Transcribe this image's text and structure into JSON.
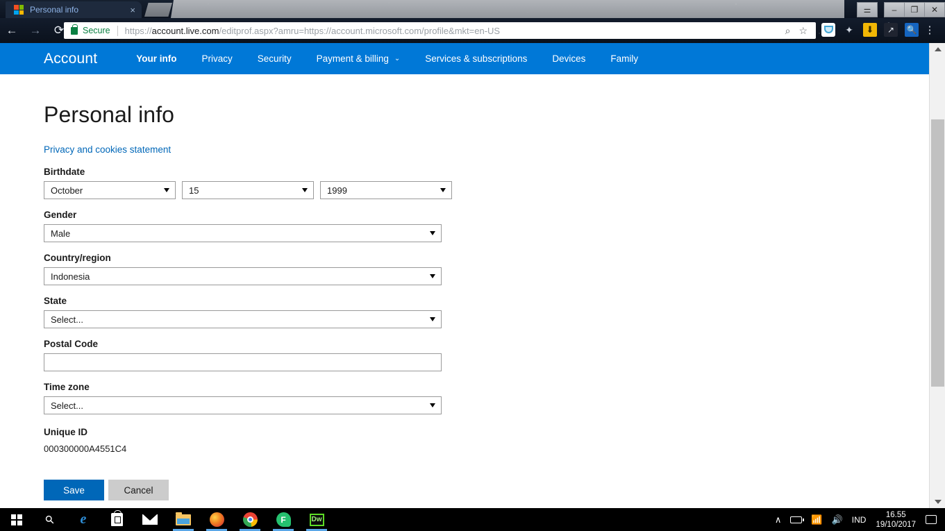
{
  "browser": {
    "tab": {
      "title": "Personal info",
      "favicon": "microsoft-logo-icon",
      "close": "×"
    },
    "nav": {
      "back": "←",
      "forward": "→",
      "reload": "⟳"
    },
    "omnibox": {
      "secure_label": "Secure",
      "url_prefix": "https://",
      "url_domain": "account.live.com",
      "url_path": "/editprof.aspx?amru=https://account.microsoft.com/profile&mkt=en-US",
      "zoom_icon": "⌕",
      "bookmark_icon": "☆"
    },
    "extensions": [
      "pocket-icon",
      "star-icon",
      "download-icon",
      "screenshot-icon",
      "magnifier-icon"
    ],
    "menu_icon": "⋮",
    "window_controls": {
      "profile": "⚌",
      "minimize": "–",
      "restore": "❐",
      "close": "✕"
    }
  },
  "site_nav": {
    "brand": "Account",
    "items": [
      {
        "label": "Your info",
        "active": true,
        "chevron": ""
      },
      {
        "label": "Privacy",
        "active": false,
        "chevron": ""
      },
      {
        "label": "Security",
        "active": false,
        "chevron": ""
      },
      {
        "label": "Payment & billing",
        "active": false,
        "chevron": "⌄"
      },
      {
        "label": "Services & subscriptions",
        "active": false,
        "chevron": ""
      },
      {
        "label": "Devices",
        "active": false,
        "chevron": ""
      },
      {
        "label": "Family",
        "active": false,
        "chevron": ""
      }
    ],
    "accent_color": "#0078d7"
  },
  "page": {
    "title": "Personal info",
    "privacy_link": "Privacy and cookies statement",
    "birthdate": {
      "label": "Birthdate",
      "month": "October",
      "day": "15",
      "year": "1999"
    },
    "gender": {
      "label": "Gender",
      "value": "Male"
    },
    "country": {
      "label": "Country/region",
      "value": "Indonesia"
    },
    "state": {
      "label": "State",
      "value": "Select..."
    },
    "postal": {
      "label": "Postal Code",
      "value": ""
    },
    "timezone": {
      "label": "Time zone",
      "value": "Select..."
    },
    "unique_id": {
      "label": "Unique ID",
      "value": "000300000A4551C4"
    },
    "buttons": {
      "save": "Save",
      "cancel": "Cancel"
    },
    "save_color": "#0067b8",
    "cancel_color": "#cccccc",
    "link_color": "#0067b8"
  },
  "taskbar": {
    "items": [
      {
        "name": "start-button",
        "running": false
      },
      {
        "name": "search-icon",
        "running": false
      },
      {
        "name": "edge-icon",
        "running": false,
        "glyph": "e"
      },
      {
        "name": "store-icon",
        "running": false
      },
      {
        "name": "mail-icon",
        "running": false
      },
      {
        "name": "file-explorer-icon",
        "running": true
      },
      {
        "name": "firefox-icon",
        "running": true
      },
      {
        "name": "chrome-icon",
        "running": true
      },
      {
        "name": "messaging-icon",
        "running": true,
        "glyph": "F"
      },
      {
        "name": "dreamweaver-icon",
        "running": true,
        "glyph": "Dw"
      }
    ],
    "tray": {
      "chevron": "∧",
      "language": "IND",
      "time": "16.55",
      "date": "19/10/2017"
    }
  }
}
